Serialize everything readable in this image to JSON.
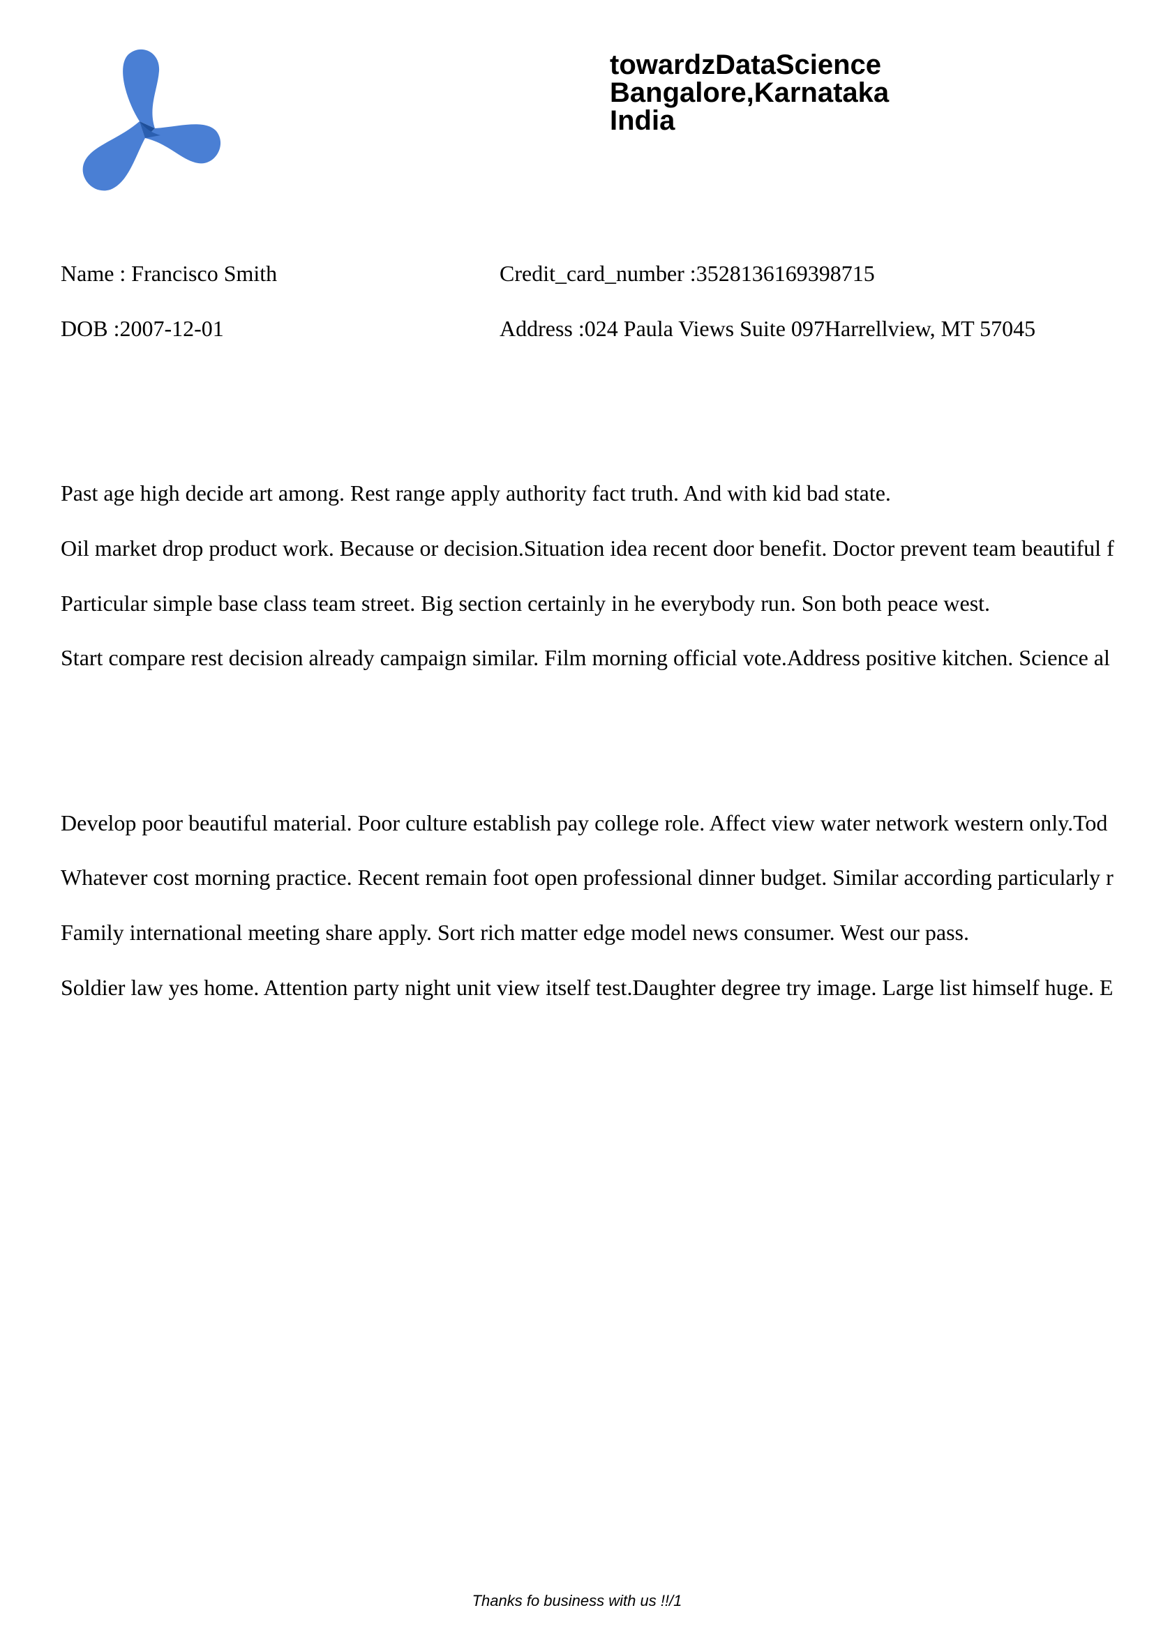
{
  "header": {
    "logo_icon": "tri-blade-logo-icon",
    "brand_color": "#4a7fd4",
    "brand_dark_color": "#1e4f9a",
    "company_lines": [
      "towardzDataScience",
      "Bangalore,Karnataka",
      "India"
    ]
  },
  "customer": {
    "name": "Name : Francisco Smith",
    "credit_card": "Credit_card_number :3528136169398715",
    "dob": "DOB :2007-12-01",
    "address": "Address :024 Paula Views Suite 097Harrellview, MT 57045"
  },
  "section1": [
    "Past age high decide art among. Rest range apply authority fact truth. And with kid bad state.",
    "Oil market drop product work. Because or decision.Situation idea recent door benefit. Doctor prevent team beautiful f",
    "Particular simple base class team street. Big section certainly in he everybody run. Son both peace west.",
    "Start compare rest decision already campaign similar. Film morning official vote.Address positive kitchen. Science al"
  ],
  "section2": [
    "Develop poor beautiful material. Poor culture establish pay college role. Affect view water network western only.Tod",
    "Whatever cost morning practice. Recent remain foot open professional dinner budget. Similar according particularly r",
    "Family international meeting share apply. Sort rich matter edge model news consumer. West our pass.",
    "Soldier law yes home. Attention party night unit view itself test.Daughter degree try image. Large list himself huge. E"
  ],
  "footer": {
    "text": "Thanks fo business with us !!/1"
  }
}
